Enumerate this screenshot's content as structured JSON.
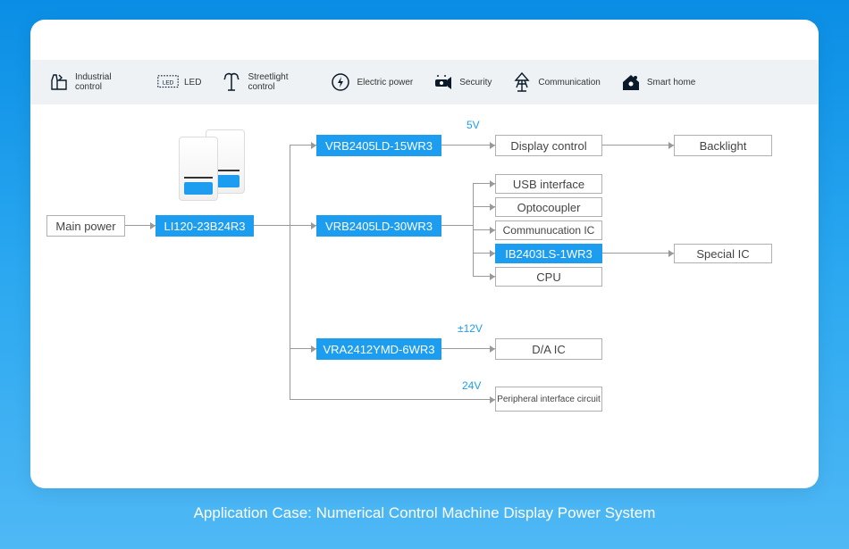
{
  "categories": [
    {
      "icon": "industrial",
      "label": "Industrial control"
    },
    {
      "icon": "led",
      "label": "LED"
    },
    {
      "icon": "streetlight",
      "label": "Streetlight control"
    },
    {
      "icon": "electric",
      "label": "Electric power"
    },
    {
      "icon": "security",
      "label": "Security"
    },
    {
      "icon": "communication",
      "label": "Communication"
    },
    {
      "icon": "smarthome",
      "label": "Smart home"
    }
  ],
  "diagram": {
    "main_power": "Main power",
    "source": "LI120-23B24R3",
    "branches": [
      {
        "converter": "VRB2405LD-15WR3",
        "voltage": "5V",
        "outputs": [
          "Display control"
        ],
        "downstream": "Backlight"
      },
      {
        "converter": "VRB2405LD-30WR3",
        "outputs": [
          "USB interface",
          "Optocoupler",
          "Communucation IC",
          {
            "label": "IB2403LS-1WR3",
            "downstream": "Special IC"
          },
          "CPU"
        ]
      },
      {
        "converter": "VRA2412YMD-6WR3",
        "voltage": "±12V",
        "outputs": [
          "D/A IC"
        ]
      },
      {
        "voltage": "24V",
        "outputs": [
          "Peripheral interface circuit"
        ]
      }
    ]
  },
  "caption": "Application Case: Numerical Control Machine Display Power System"
}
